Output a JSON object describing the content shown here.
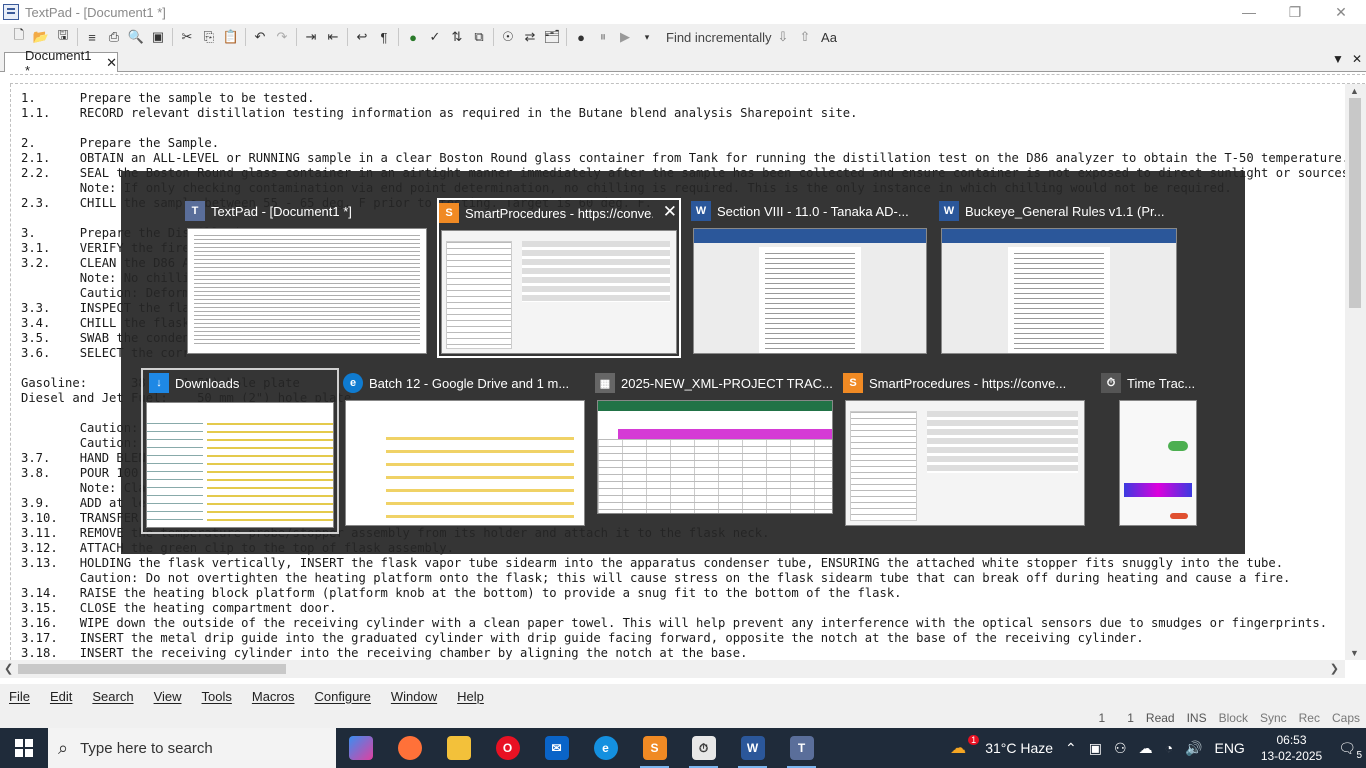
{
  "window": {
    "title": "TextPad - [Document1 *]"
  },
  "toolbar": {
    "find_label": "Find incrementally",
    "case_label": "Aa"
  },
  "document_tab": {
    "label": "Document1 *"
  },
  "editor": {
    "lines": [
      "1.      Prepare the sample to be tested.",
      "1.1.    RECORD relevant distillation testing information as required in the Butane blend analysis Sharepoint site.",
      "",
      "2.      Prepare the Sample.",
      "2.1.    OBTAIN an ALL-LEVEL or RUNNING sample in a clear Boston Round glass container from Tank for running the distillation test on the D86 analyzer to obtain the T-50 temperature.",
      "2.2.    SEAL the Boston Round glass container in an airtight manner immediately after the sample has been collected and ensure container is not exposed to direct sunlight or sources of dire",
      "        Note: If only checking contamination via end point determination, no chilling is required. This is the only instance in which chilling would not be required.",
      "2.3.    CHILL the sample between 55 - 65 deg. F prior to testing. Target is 60 deg. F.",
      "",
      "3.      Prepare the Distillation Apparatus.",
      "3.1.    VERIFY the fire",
      "3.2.    CLEAN the D86 A",
      "        Note: No chilli",
      "        Caution: Deform",
      "3.3.    INSPECT the fla",
      "3.4.    CHILL the flask",
      "3.5.    SWAB the conden",
      "3.6.    SELECT the corr",
      "",
      "Gasoline:      38 mm (1.5\") hole plate",
      "Diesel and Jet Fuel:    50 mm (2\") hole plate",
      "",
      "        Caution:",
      "        Caution:",
      "3.7.    HAND BLEND",
      "3.8.    POUR 100",
      "        Note: Cla",
      "3.9.    ADD at le",
      "3.10.   TRANSFER",
      "3.11.   REMOVE the temperature probe/stopper assembly from its holder and attach it to the flask neck.",
      "3.12.   ATTACH the green clip to the top of flask assembly.",
      "3.13.   HOLDING the flask vertically, INSERT the flask vapor tube sidearm into the apparatus condenser tube, ENSURING the attached white stopper fits snuggly into the tube.",
      "        Caution: Do not overtighten the heating platform onto the flask; this will cause stress on the flask sidearm tube that can break off during heating and cause a fire.",
      "3.14.   RAISE the heating block platform (platform knob at the bottom) to provide a snug fit to the bottom of the flask.",
      "3.15.   CLOSE the heating compartment door.",
      "3.16.   WIPE down the outside of the receiving cylinder with a clean paper towel. This will help prevent any interference with the optical sensors due to smudges or fingerprints.",
      "3.17.   INSERT the metal drip guide into the graduated cylinder with drip guide facing forward, opposite the notch at the base of the receiving cylinder.",
      "3.18.   INSERT the receiving cylinder into the receiving chamber by aligning the notch at the base."
    ]
  },
  "menubar": {
    "items": [
      "File",
      "Edit",
      "Search",
      "View",
      "Tools",
      "Macros",
      "Configure",
      "Window",
      "Help"
    ]
  },
  "statusbar": {
    "line": "1",
    "col": "1",
    "read": "Read",
    "ins": "INS",
    "block": "Block",
    "sync": "Sync",
    "rec": "Rec",
    "caps": "Caps"
  },
  "switcher": {
    "windows": [
      {
        "title": "TextPad - [Document1 *]",
        "icon": "textpad-icon",
        "selected": false
      },
      {
        "title": "SmartProcedures - https://conve...",
        "icon": "smartprocedures-icon",
        "selected": true
      },
      {
        "title": "Section VIII - 11.0 - Tanaka AD-...",
        "icon": "word-icon",
        "selected": false
      },
      {
        "title": "Buckeye_General Rules v1.1 (Pr...",
        "icon": "word-icon",
        "selected": false
      },
      {
        "title": "Downloads",
        "icon": "downloads-icon",
        "selected": false
      },
      {
        "title": "Batch 12 - Google Drive and 1 m...",
        "icon": "edge-icon",
        "selected": false
      },
      {
        "title": "2025-NEW_XML-PROJECT TRAC...",
        "icon": "spreadsheet-icon",
        "selected": false
      },
      {
        "title": "SmartProcedures - https://conve...",
        "icon": "smartprocedures-icon",
        "selected": false
      },
      {
        "title": "Time Trac...",
        "icon": "timetracker-icon",
        "selected": false
      }
    ]
  },
  "taskbar": {
    "search_placeholder": "Type here to search",
    "weather": "31°C  Haze",
    "language": "ENG",
    "time": "06:53",
    "date": "13-02-2025",
    "notification_count": "5",
    "weather_badge": "1"
  }
}
